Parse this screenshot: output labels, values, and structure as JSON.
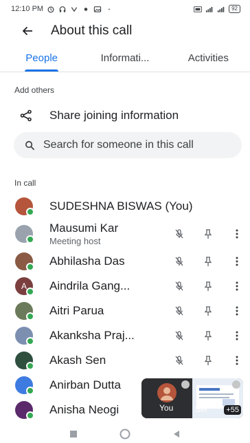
{
  "status_bar": {
    "time": "12:10 PM",
    "battery": "92"
  },
  "header": {
    "title": "About this call",
    "back_icon": "arrow-left-icon"
  },
  "tabs": [
    {
      "label": "People",
      "active": true
    },
    {
      "label": "Informati...",
      "active": false
    },
    {
      "label": "Activities",
      "active": false
    }
  ],
  "add_others": {
    "label": "Add others",
    "share_label": "Share joining information",
    "share_icon": "share-icon"
  },
  "search": {
    "placeholder": "Search for someone in this call",
    "icon": "search-icon"
  },
  "in_call": {
    "label": "In call",
    "participants": [
      {
        "name": "SUDESHNA BISWAS (You)",
        "subtitle": "",
        "avatar_color": "#b5553b",
        "initial": "",
        "actions": false
      },
      {
        "name": "Mausumi Kar",
        "subtitle": "Meeting host",
        "avatar_color": "#9aa3ad",
        "initial": "",
        "actions": true
      },
      {
        "name": "Abhilasha Das",
        "subtitle": "",
        "avatar_color": "#8a5a44",
        "initial": "",
        "actions": true
      },
      {
        "name": "Aindrila Gang...",
        "subtitle": "",
        "avatar_color": "#7b3f3f",
        "initial": "A",
        "actions": true
      },
      {
        "name": "Aitri Parua",
        "subtitle": "",
        "avatar_color": "#6b7a5a",
        "initial": "",
        "actions": true
      },
      {
        "name": "Akanksha Praj...",
        "subtitle": "",
        "avatar_color": "#7d8fb0",
        "initial": "",
        "actions": true
      },
      {
        "name": "Akash Sen",
        "subtitle": "",
        "avatar_color": "#2f4f3f",
        "initial": "",
        "actions": true
      },
      {
        "name": "Anirban Dutta",
        "subtitle": "",
        "avatar_color": "#3d7be0",
        "initial": "",
        "actions": false
      },
      {
        "name": "Anisha Neogi",
        "subtitle": "",
        "avatar_color": "#5a2a6a",
        "initial": "",
        "actions": false
      }
    ]
  },
  "pip": {
    "self_label": "You",
    "partial_label": "Ser",
    "count": "+55"
  },
  "colors": {
    "accent": "#1a73e8",
    "online": "#34a853"
  }
}
